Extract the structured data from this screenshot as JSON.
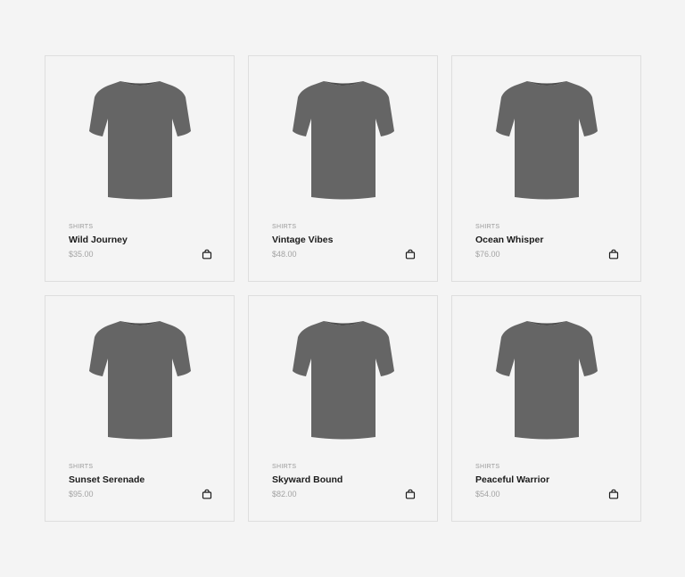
{
  "products": [
    {
      "category": "SHIRTS",
      "name": "Wild Journey",
      "price": "$35.00",
      "image": "t-shirt-image",
      "cart_icon": "shopping-bag-icon"
    },
    {
      "category": "SHIRTS",
      "name": "Vintage Vibes",
      "price": "$48.00",
      "image": "t-shirt-image",
      "cart_icon": "shopping-bag-icon"
    },
    {
      "category": "SHIRTS",
      "name": "Ocean Whisper",
      "price": "$76.00",
      "image": "t-shirt-image",
      "cart_icon": "shopping-bag-icon"
    },
    {
      "category": "SHIRTS",
      "name": "Sunset Serenade",
      "price": "$95.00",
      "image": "t-shirt-image",
      "cart_icon": "shopping-bag-icon"
    },
    {
      "category": "SHIRTS",
      "name": "Skyward Bound",
      "price": "$82.00",
      "image": "t-shirt-image",
      "cart_icon": "shopping-bag-icon"
    },
    {
      "category": "SHIRTS",
      "name": "Peaceful Warrior",
      "price": "$54.00",
      "image": "t-shirt-image",
      "cart_icon": "shopping-bag-icon"
    }
  ],
  "colors": {
    "background": "#f4f4f4",
    "card_border": "#dedede",
    "shirt": "#656565",
    "title": "#1b1b1b",
    "muted": "#9a9a9a"
  }
}
